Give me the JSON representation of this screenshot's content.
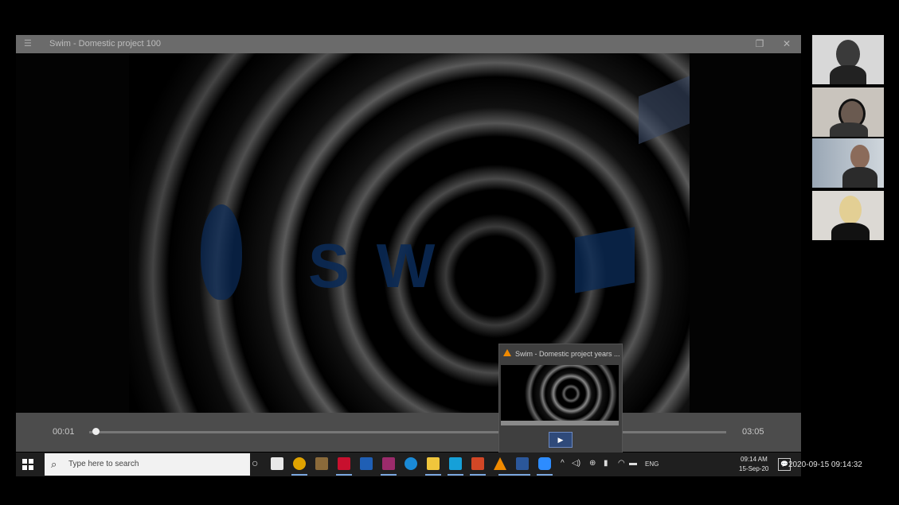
{
  "player": {
    "title": "Swim - Domestic project 100",
    "current_time": "00:01",
    "total_time": "03:05",
    "progress_fraction": 0.01,
    "video_logo_text": "S W"
  },
  "preview": {
    "title": "Swim - Domestic project years ..."
  },
  "participants": [
    {
      "name_icon": "participant-1-video"
    },
    {
      "name_icon": "participant-2-video"
    },
    {
      "name_icon": "participant-3-video"
    },
    {
      "name_icon": "participant-4-video"
    }
  ],
  "taskbar": {
    "search_placeholder": "Type here to search",
    "clock_time": "09:14 AM",
    "clock_date": "15-Sep-20",
    "tray_language": "ENG"
  },
  "recording_timestamp": "2020-09-15 09:14:32",
  "colors": {
    "titlebar": "#6b6b6b",
    "taskbar": "#1f1f1f",
    "accent": "#79a6de",
    "logo_blue": "#0b2a55"
  }
}
